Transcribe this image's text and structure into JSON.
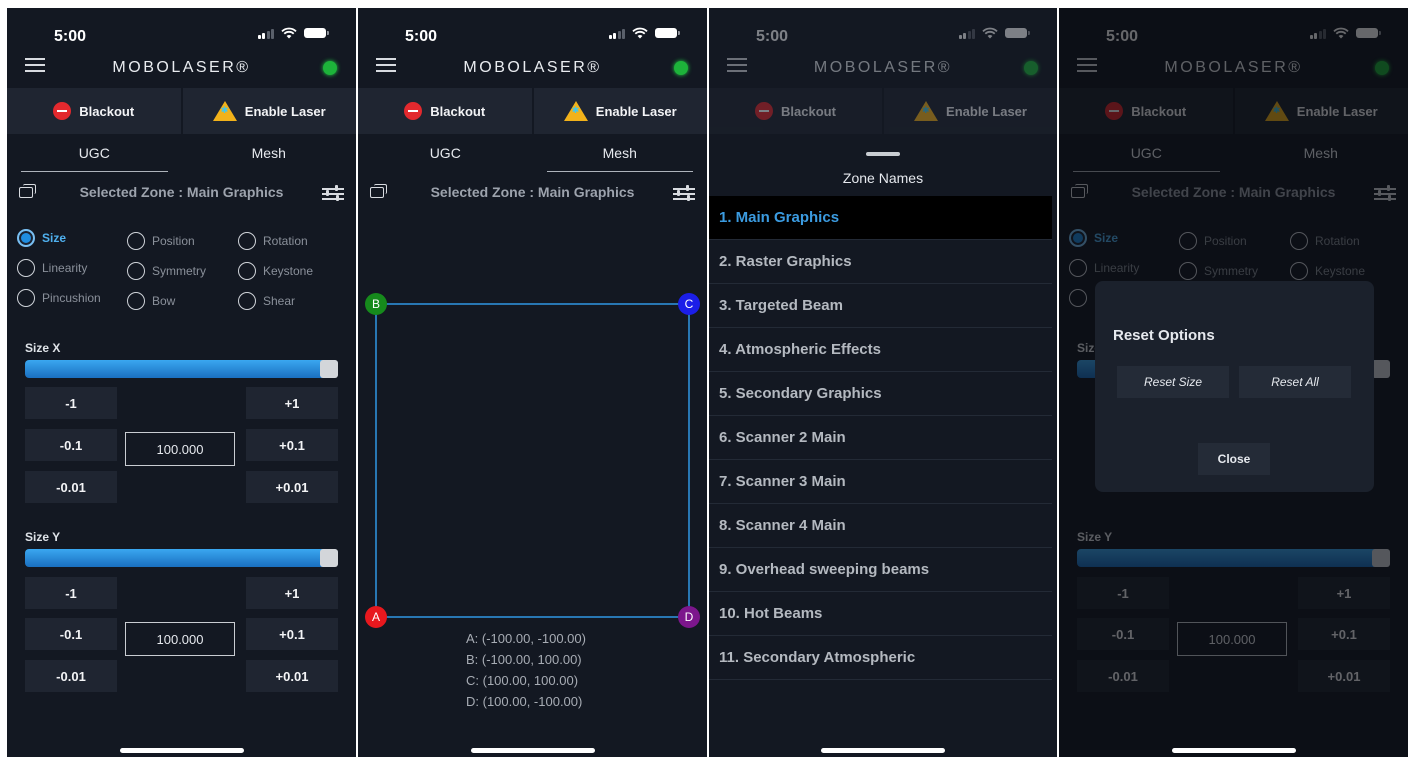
{
  "status": {
    "time": "5:00"
  },
  "app": {
    "brand": "MOBOLASER®"
  },
  "actions": {
    "blackout": "Blackout",
    "enable_laser": "Enable Laser"
  },
  "tabs": {
    "ugc": "UGC",
    "mesh": "Mesh"
  },
  "zone": {
    "selected": "Selected Zone : Main Graphics"
  },
  "effects": [
    "Size",
    "Position",
    "Rotation",
    "Linearity",
    "Symmetry",
    "Keystone",
    "Pincushion",
    "Bow",
    "Shear"
  ],
  "size_x": {
    "label": "Size X",
    "value": "100.000",
    "slider_level": 1.0
  },
  "size_y": {
    "label": "Size Y",
    "value": "100.000",
    "slider_level": 1.0
  },
  "steps": {
    "m1": "-1",
    "p1": "+1",
    "m01": "-0.1",
    "p01": "+0.1",
    "m001": "-0.01",
    "p001": "+0.01"
  },
  "mesh": {
    "corners": {
      "a": "A",
      "b": "B",
      "c": "C",
      "d": "D"
    },
    "corner_colors": {
      "a": "#e8181e",
      "b": "#168a1c",
      "c": "#1b1ee8",
      "d": "#7c168c",
      "frame": "#2e8fd8"
    },
    "coords": [
      "A: (-100.00, -100.00)",
      "B: (-100.00, 100.00)",
      "C: (100.00, 100.00)",
      "D: (100.00, -100.00)"
    ]
  },
  "zone_sheet": {
    "title": "Zone Names",
    "items": [
      "1. Main Graphics",
      "2. Raster Graphics",
      "3. Targeted Beam",
      "4. Atmospheric Effects",
      "5. Secondary Graphics",
      "6. Scanner 2 Main",
      "7. Scanner 3 Main",
      "8. Scanner 4 Main",
      "9. Overhead sweeping beams",
      "10. Hot Beams",
      "11. Secondary Atmospheric"
    ]
  },
  "reset_dialog": {
    "title": "Reset Options",
    "reset_size": "Reset Size",
    "reset_all": "Reset All",
    "close": "Close"
  },
  "colors": {
    "background": "#131822",
    "accent": "#1f8de0",
    "led": "#1db33a"
  }
}
